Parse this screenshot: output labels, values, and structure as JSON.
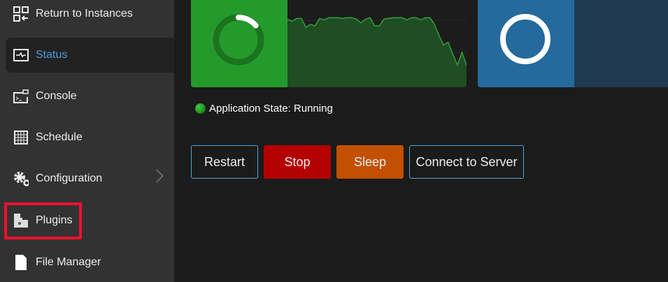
{
  "sidebar": {
    "items": [
      {
        "label": "Return to Instances",
        "icon": "return-instances-icon"
      },
      {
        "label": "Status",
        "icon": "status-icon",
        "active": true
      },
      {
        "label": "Console",
        "icon": "console-icon"
      },
      {
        "label": "Schedule",
        "icon": "schedule-icon"
      },
      {
        "label": "Configuration",
        "icon": "gears-icon",
        "has_submenu": true
      },
      {
        "label": "Plugins",
        "icon": "puzzle-icon",
        "highlighted": true
      },
      {
        "label": "File Manager",
        "icon": "file-icon"
      }
    ]
  },
  "cpu_card": {
    "color": "#259a2c",
    "gauge_fraction": 0.14,
    "history": [
      92,
      89,
      93,
      93,
      81,
      85,
      83,
      93,
      91,
      94,
      94,
      94,
      93,
      94,
      94,
      92,
      87,
      92,
      94,
      83,
      83,
      92,
      93,
      94,
      94,
      94,
      91,
      94,
      94,
      91,
      94,
      94,
      85,
      70,
      57,
      61,
      45,
      30,
      47,
      30
    ]
  },
  "memory_card": {
    "color": "#246a9c",
    "gauge_fraction": 1.0
  },
  "status": {
    "label": "Application State: Running"
  },
  "buttons": {
    "restart": "Restart",
    "stop": "Stop",
    "sleep": "Sleep",
    "connect": "Connect to Server"
  },
  "colors": {
    "stop": "#b40000",
    "sleep": "#c25000",
    "outline": "#4fa3dc"
  }
}
